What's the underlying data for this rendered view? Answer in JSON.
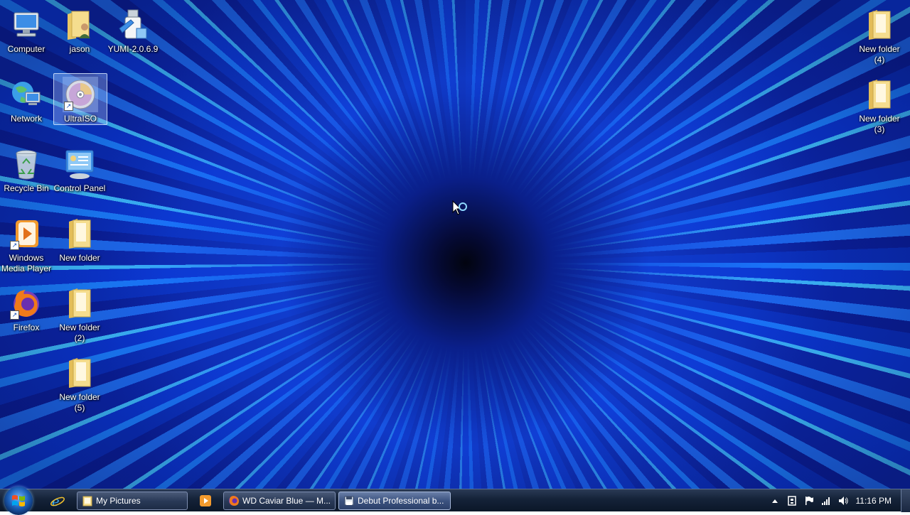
{
  "desktop": {
    "icons": [
      {
        "label": "Computer",
        "icon": "computer-icon"
      },
      {
        "label": "jason",
        "icon": "user-folder-icon"
      },
      {
        "label": "YUMI-2.0.6.9",
        "icon": "usb-installer-icon"
      },
      {
        "label": "Network",
        "icon": "network-icon"
      },
      {
        "label": "UltraISO",
        "icon": "disc-icon"
      },
      {
        "label": "Recycle Bin",
        "icon": "recycle-bin-icon"
      },
      {
        "label": "Control Panel",
        "icon": "control-panel-icon"
      },
      {
        "label": "Windows Media Player",
        "icon": "media-player-icon"
      },
      {
        "label": "New folder",
        "icon": "folder-icon"
      },
      {
        "label": "Firefox",
        "icon": "firefox-icon"
      },
      {
        "label": "New folder (2)",
        "icon": "folder-icon"
      },
      {
        "label": "New folder (5)",
        "icon": "folder-icon"
      },
      {
        "label": "New folder (4)",
        "icon": "folder-icon"
      },
      {
        "label": "New folder (3)",
        "icon": "folder-icon"
      }
    ],
    "selected": "UltraISO"
  },
  "taskbar": {
    "start_icon": "windows-start-icon",
    "quick_launch": [
      "internet-explorer-icon",
      "media-player-icon"
    ],
    "buttons": [
      {
        "label": "My Pictures",
        "icon": "folder-icon"
      },
      {
        "label": "WD Caviar Blue — M...",
        "icon": "firefox-icon"
      },
      {
        "label": "Debut Professional b...",
        "icon": "floppy-icon"
      }
    ],
    "tray": [
      "show-hidden-icons-icon",
      "network-tray-icon",
      "action-center-flag-icon",
      "signal-icon",
      "volume-icon"
    ],
    "clock": "11:16 PM"
  },
  "colors": {
    "wallpaper_primary": "#0a2ab0",
    "wallpaper_streak": "#1b7fff",
    "taskbar": "#142238",
    "folder": "#f2d27a"
  }
}
